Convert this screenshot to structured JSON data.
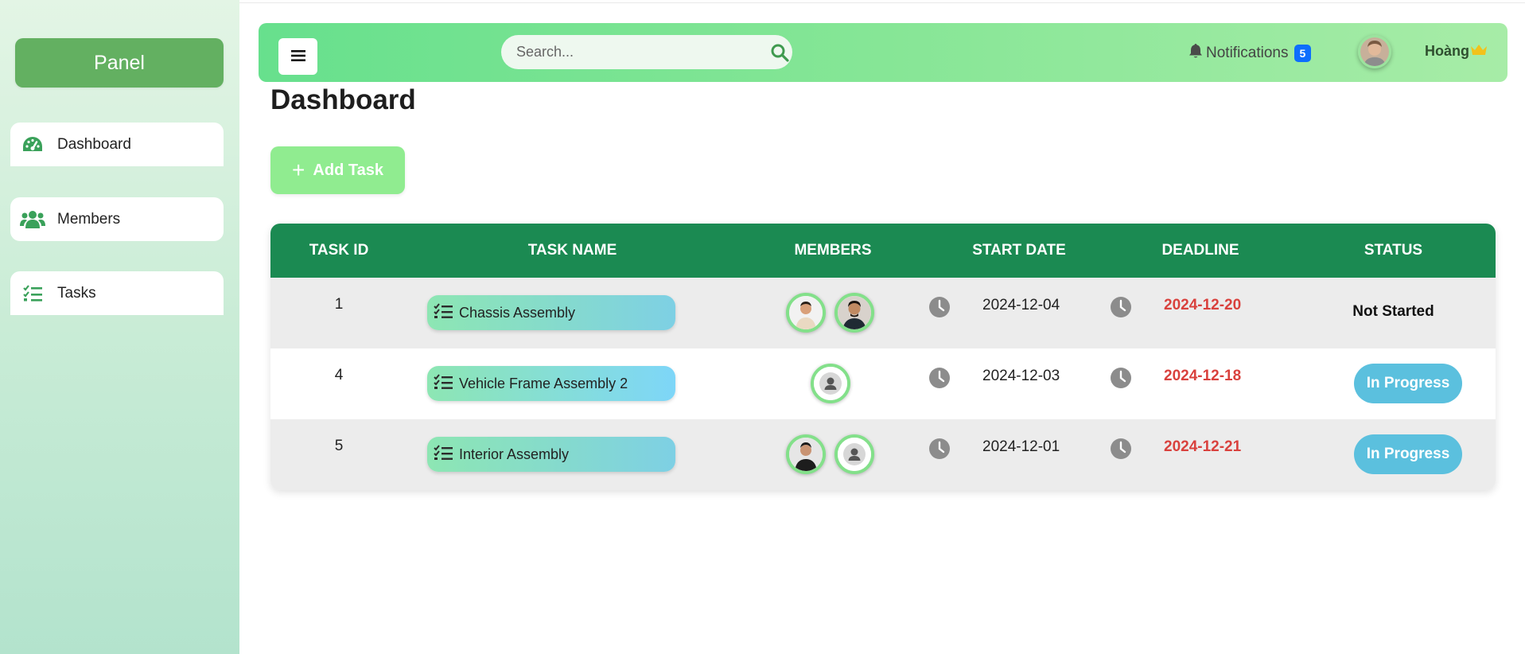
{
  "sidebar": {
    "panel_label": "Panel",
    "items": [
      {
        "label": "Dashboard",
        "icon": "speedometer-icon"
      },
      {
        "label": "Members",
        "icon": "users-icon"
      },
      {
        "label": "Tasks",
        "icon": "task-list-icon"
      }
    ]
  },
  "topbar": {
    "search_placeholder": "Search...",
    "notifications_label": "Notifications",
    "notifications_count": "5",
    "username": "Hoàng"
  },
  "main": {
    "title": "Dashboard",
    "add_task_label": "Add Task"
  },
  "table": {
    "headers": [
      "TASK ID",
      "TASK NAME",
      "MEMBERS",
      "START DATE",
      "DEADLINE",
      "STATUS"
    ],
    "rows": [
      {
        "id": "1",
        "name": "Chassis Assembly",
        "members": [
          "photo",
          "photo"
        ],
        "start": "2024-12-04",
        "deadline": "2024-12-20",
        "status": "Not Started"
      },
      {
        "id": "4",
        "name": "Vehicle Frame Assembly 2",
        "members": [
          "default"
        ],
        "start": "2024-12-03",
        "deadline": "2024-12-18",
        "status": "In Progress"
      },
      {
        "id": "5",
        "name": "Interior Assembly",
        "members": [
          "photo",
          "default"
        ],
        "start": "2024-12-01",
        "deadline": "2024-12-21",
        "status": "In Progress"
      }
    ]
  },
  "colors": {
    "header_green": "#1b8a52",
    "deadline_red": "#d9413d",
    "status_blue": "#5bc0de",
    "badge_blue": "#0d6efd",
    "accent_green": "#63b061"
  }
}
